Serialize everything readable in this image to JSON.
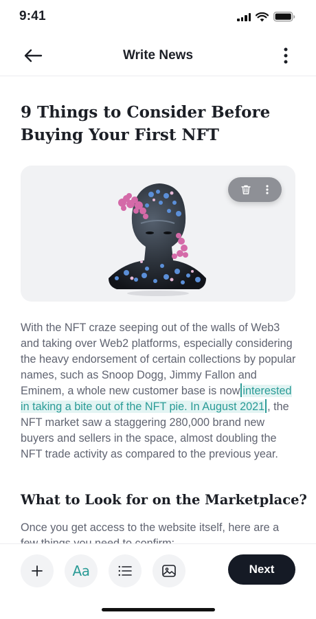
{
  "status_bar": {
    "time": "9:41"
  },
  "app_bar": {
    "title": "Write News",
    "back_icon": "arrow-left-icon",
    "more_icon": "more-vertical-icon"
  },
  "article": {
    "title": "9 Things to Consider Before Buying Your First NFT",
    "image_alt": "3D digital bust covered in coral and crystal growths",
    "image_actions": [
      "trash-icon",
      "more-vertical-icon"
    ],
    "paragraph": {
      "before_selection": "With the NFT craze seeping out of the walls of Web3 and taking over Web2 platforms, especially considering the heavy endorsement of certain collections by popular names, such as Snoop Dogg, Jimmy Fallon and Eminem, a whole new customer base is now",
      "selected_text": "interested in taking a bite out of the NFT pie. In August 2021",
      "after_selection": ", the NFT market saw a staggering 280,000 brand new buyers and sellers in the space, almost doubling the NFT trade activity as compared to the previous year."
    },
    "subheading": "What to Look for on the Marketplace?",
    "paragraph2": "Once you get access to the website itself, here are a few things you need to confirm:"
  },
  "toolbar": {
    "buttons": [
      "plus-icon",
      "text-format-icon",
      "list-icon",
      "image-icon"
    ],
    "text_format_glyph": "Aa",
    "next_label": "Next"
  },
  "colors": {
    "accent": "#2a9b96",
    "selection_bg": "#e3f4f3",
    "primary_button": "#151a25"
  }
}
